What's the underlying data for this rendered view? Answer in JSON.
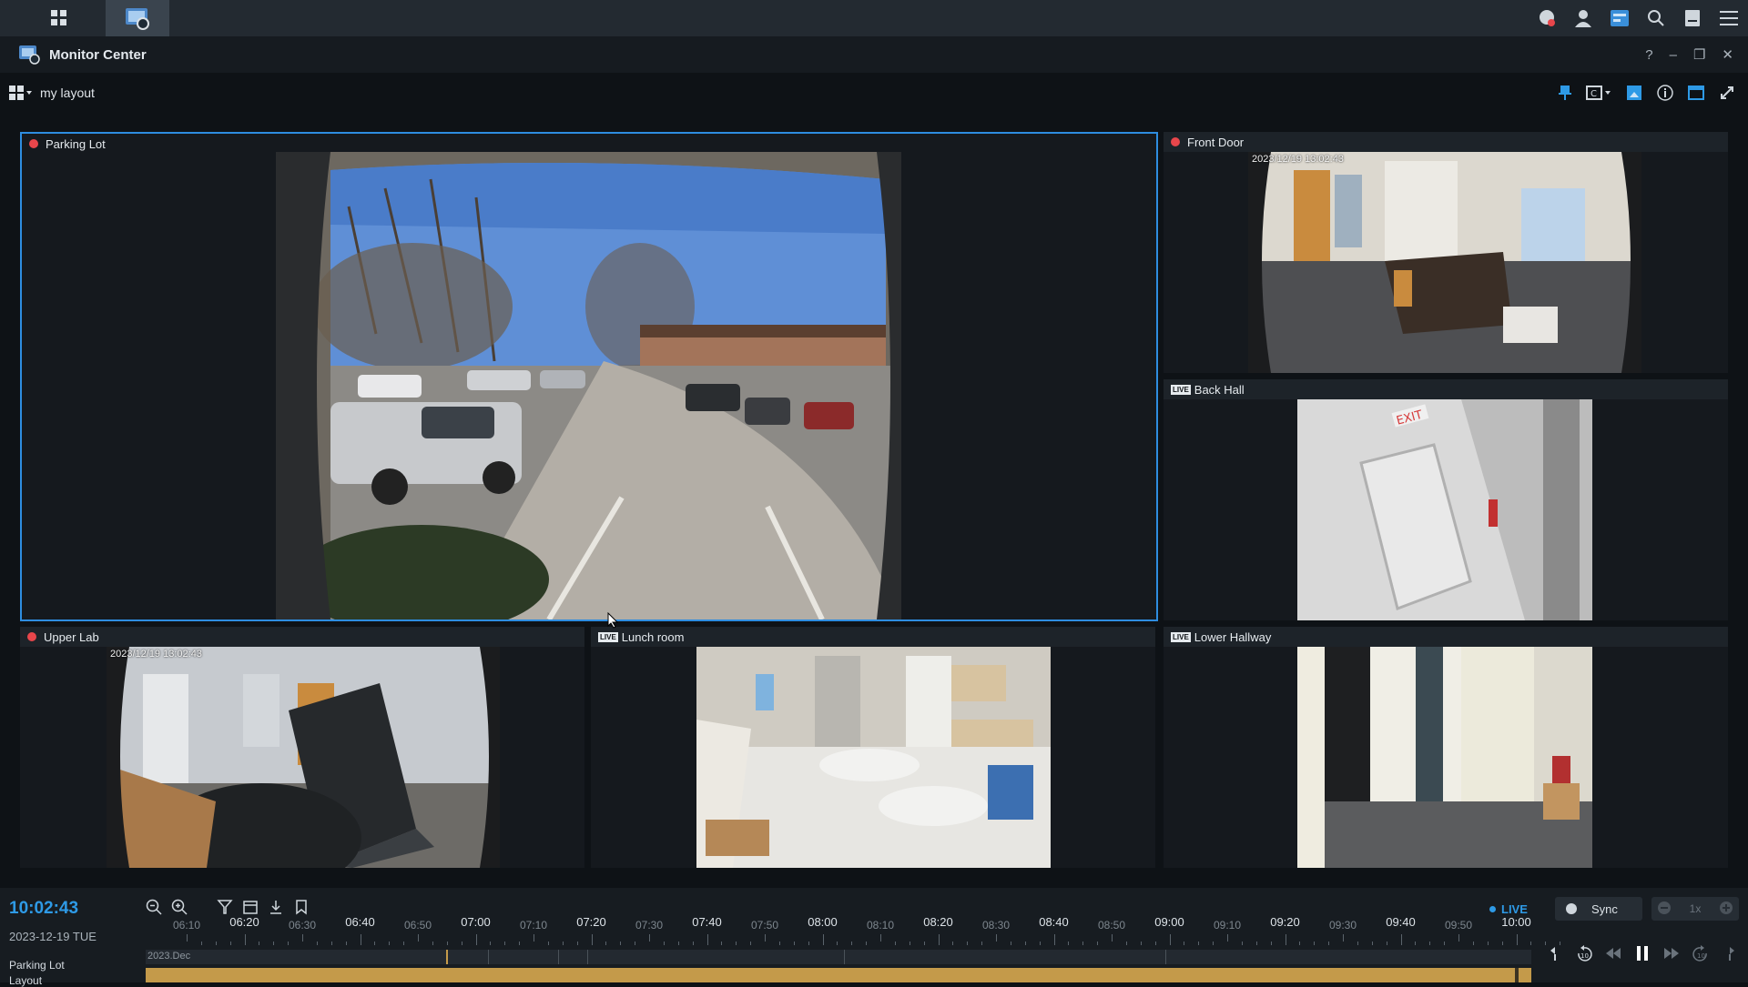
{
  "window": {
    "title": "Monitor Center",
    "controls": [
      "?",
      "–",
      "❐",
      "✕"
    ]
  },
  "toolbar": {
    "layout_name": "my layout"
  },
  "panes": {
    "parking_lot": {
      "label": "Parking Lot",
      "status": "recording"
    },
    "front_door": {
      "label": "Front Door",
      "status": "recording",
      "timestamp": "2023/12/19 13:02:43"
    },
    "back_hall": {
      "label": "Back Hall",
      "status": "live"
    },
    "upper_lab": {
      "label": "Upper Lab",
      "status": "recording",
      "timestamp": "2023/12/19 13:02:43"
    },
    "lunch_room": {
      "label": "Lunch room",
      "status": "live"
    },
    "lower_hallway": {
      "label": "Lower Hallway",
      "status": "live"
    }
  },
  "live_tag": "LIVE",
  "timeline": {
    "clock": "10:02:43",
    "date": "2023-12-19 TUE",
    "live_label": "LIVE",
    "sync_label": "Sync",
    "speed_label": "1x",
    "major_ticks": [
      "06:20",
      "06:40",
      "07:00",
      "07:20",
      "07:40",
      "08:00",
      "08:20",
      "08:40",
      "09:00",
      "09:20",
      "09:40",
      "10:00"
    ],
    "minor_ticks": [
      "06:10",
      "06:30",
      "06:50",
      "07:10",
      "07:30",
      "07:50",
      "08:10",
      "08:30",
      "08:50",
      "09:10",
      "09:30",
      "09:50"
    ],
    "tracks": {
      "camera": "Parking Lot",
      "layout": "Layout",
      "month": "2023.Dec"
    }
  },
  "colors": {
    "accent": "#2e9ae6",
    "recording": "#e8464b",
    "selection": "#2e8de0",
    "layout_track": "#c49a4a"
  }
}
